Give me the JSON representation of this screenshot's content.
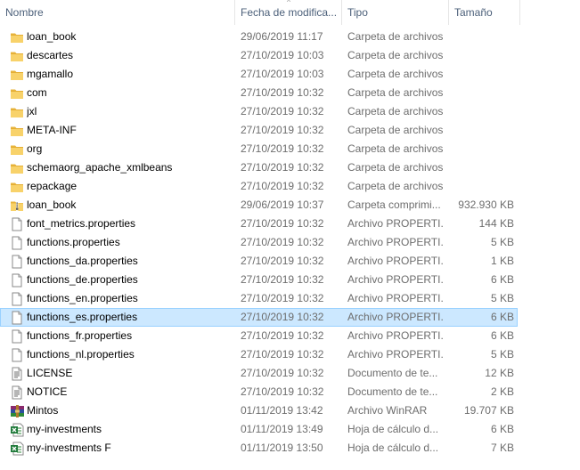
{
  "columns": {
    "name": "Nombre",
    "date": "Fecha de modifica...",
    "type": "Tipo",
    "size": "Tamaño"
  },
  "colors": {
    "selection_bg": "#cce8ff",
    "selection_border": "#99d1ff",
    "folder": "#f5c542",
    "header_text": "#4c607a"
  },
  "files": [
    {
      "name": "loan_book",
      "date": "29/06/2019 11:17",
      "type": "Carpeta de archivos",
      "size": "",
      "icon": "folder-icon"
    },
    {
      "name": "descartes",
      "date": "27/10/2019 10:03",
      "type": "Carpeta de archivos",
      "size": "",
      "icon": "folder-icon"
    },
    {
      "name": "mgamallo",
      "date": "27/10/2019 10:03",
      "type": "Carpeta de archivos",
      "size": "",
      "icon": "folder-icon"
    },
    {
      "name": "com",
      "date": "27/10/2019 10:32",
      "type": "Carpeta de archivos",
      "size": "",
      "icon": "folder-icon"
    },
    {
      "name": "jxl",
      "date": "27/10/2019 10:32",
      "type": "Carpeta de archivos",
      "size": "",
      "icon": "folder-icon"
    },
    {
      "name": "META-INF",
      "date": "27/10/2019 10:32",
      "type": "Carpeta de archivos",
      "size": "",
      "icon": "folder-icon"
    },
    {
      "name": "org",
      "date": "27/10/2019 10:32",
      "type": "Carpeta de archivos",
      "size": "",
      "icon": "folder-icon"
    },
    {
      "name": "schemaorg_apache_xmlbeans",
      "date": "27/10/2019 10:32",
      "type": "Carpeta de archivos",
      "size": "",
      "icon": "folder-icon"
    },
    {
      "name": "repackage",
      "date": "27/10/2019 10:32",
      "type": "Carpeta de archivos",
      "size": "",
      "icon": "folder-icon"
    },
    {
      "name": "loan_book",
      "date": "29/06/2019 10:37",
      "type": "Carpeta comprimi...",
      "size": "932.930 KB",
      "icon": "zip-folder-icon"
    },
    {
      "name": "font_metrics.properties",
      "date": "27/10/2019 10:32",
      "type": "Archivo PROPERTI...",
      "size": "144 KB",
      "icon": "file-icon"
    },
    {
      "name": "functions.properties",
      "date": "27/10/2019 10:32",
      "type": "Archivo PROPERTI...",
      "size": "5 KB",
      "icon": "file-icon"
    },
    {
      "name": "functions_da.properties",
      "date": "27/10/2019 10:32",
      "type": "Archivo PROPERTI...",
      "size": "1 KB",
      "icon": "file-icon"
    },
    {
      "name": "functions_de.properties",
      "date": "27/10/2019 10:32",
      "type": "Archivo PROPERTI...",
      "size": "6 KB",
      "icon": "file-icon"
    },
    {
      "name": "functions_en.properties",
      "date": "27/10/2019 10:32",
      "type": "Archivo PROPERTI...",
      "size": "5 KB",
      "icon": "file-icon"
    },
    {
      "name": "functions_es.properties",
      "date": "27/10/2019 10:32",
      "type": "Archivo PROPERTI...",
      "size": "6 KB",
      "icon": "file-icon",
      "selected": true
    },
    {
      "name": "functions_fr.properties",
      "date": "27/10/2019 10:32",
      "type": "Archivo PROPERTI...",
      "size": "6 KB",
      "icon": "file-icon"
    },
    {
      "name": "functions_nl.properties",
      "date": "27/10/2019 10:32",
      "type": "Archivo PROPERTI...",
      "size": "5 KB",
      "icon": "file-icon"
    },
    {
      "name": "LICENSE",
      "date": "27/10/2019 10:32",
      "type": "Documento de te...",
      "size": "12 KB",
      "icon": "text-document-icon"
    },
    {
      "name": "NOTICE",
      "date": "27/10/2019 10:32",
      "type": "Documento de te...",
      "size": "2 KB",
      "icon": "text-document-icon"
    },
    {
      "name": "Mintos",
      "date": "01/11/2019 13:42",
      "type": "Archivo WinRAR",
      "size": "19.707 KB",
      "icon": "winrar-archive-icon"
    },
    {
      "name": "my-investments",
      "date": "01/11/2019 13:49",
      "type": "Hoja de cálculo d...",
      "size": "6 KB",
      "icon": "excel-icon"
    },
    {
      "name": "my-investments F",
      "date": "01/11/2019 13:50",
      "type": "Hoja de cálculo d...",
      "size": "7 KB",
      "icon": "excel-icon"
    }
  ]
}
